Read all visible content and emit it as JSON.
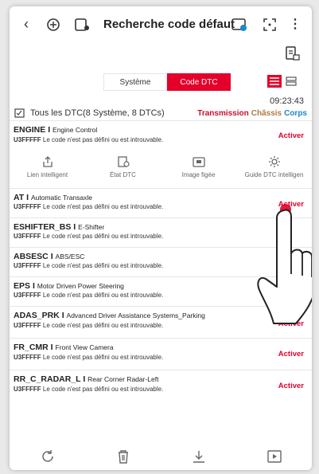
{
  "header": {
    "title": "Recherche code défaut"
  },
  "tabs": [
    {
      "label": "Système",
      "active": false
    },
    {
      "label": "Code DTC",
      "active": true
    }
  ],
  "summary": {
    "time": "09:23:43",
    "text": "Tous les DTC(8 Système, 8 DTCs)",
    "filters": [
      "Transmission",
      "Châssis",
      "Corps"
    ]
  },
  "actions": [
    {
      "label": "Lien intelligent",
      "icon": "share-icon"
    },
    {
      "label": "État DTC",
      "icon": "dtc-status-icon"
    },
    {
      "label": "Image figée",
      "icon": "freeze-frame-icon"
    },
    {
      "label": "Guide DTC intelligen",
      "icon": "gear-icon"
    }
  ],
  "dtcs": [
    {
      "system": "ENGINE",
      "desc": "Engine Control",
      "code": "U3FFFFF",
      "message": "Le code n'est pas défini ou est introuvable.",
      "action": "Activer"
    },
    {
      "system": "AT",
      "desc": "Automatic Transaxle",
      "code": "U3FFFFF",
      "message": "Le code n'est pas défini ou est introuvable.",
      "action": "Activer"
    },
    {
      "system": "ESHIFTER_BS",
      "desc": "E-Shifter",
      "code": "U3FFFFF",
      "message": "Le code n'est pas défini ou est introuvable.",
      "action": ""
    },
    {
      "system": "ABSESC",
      "desc": "ABS/ESC",
      "code": "U3FFFFF",
      "message": "Le code n'est pas défini ou est introuvable.",
      "action": ""
    },
    {
      "system": "EPS",
      "desc": "Motor Driven Power Steering",
      "code": "U3FFFFF",
      "message": "Le code n'est pas défini ou est introuvable.",
      "action": ""
    },
    {
      "system": "ADAS_PRK",
      "desc": "Advanced Driver Assistance Systems_Parking",
      "code": "U3FFFFF",
      "message": "Le code n'est pas défini ou est introuvable.",
      "action": "Activer"
    },
    {
      "system": "FR_CMR",
      "desc": "Front View Camera",
      "code": "U3FFFFF",
      "message": "Le code n'est pas défini ou est introuvable.",
      "action": "Activer"
    },
    {
      "system": "RR_C_RADAR_L",
      "desc": "Rear Corner Radar-Left",
      "code": "U3FFFFF",
      "message": "Le code n'est pas défini ou est introuvable.",
      "action": "Activer"
    }
  ],
  "separator": "I",
  "colors": {
    "accent": "#e4002b",
    "transmission": "#c8102e",
    "chassis": "#b07a44",
    "body": "#1e88c9"
  },
  "bottom_icons": [
    "refresh-icon",
    "trash-icon",
    "download-icon",
    "play-icon"
  ]
}
